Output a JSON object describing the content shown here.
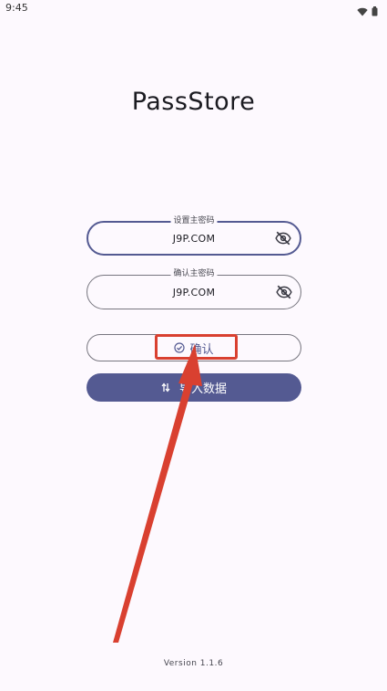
{
  "status_bar": {
    "time": "9:45",
    "icons": [
      "wifi-icon",
      "battery-icon"
    ]
  },
  "app": {
    "title": "PassStore",
    "version": "Version 1.1.6"
  },
  "form": {
    "set_password": {
      "label": "设置主密码",
      "value": "J9P.COM",
      "visibility_icon": "eye-off-icon"
    },
    "confirm_password": {
      "label": "确认主密码",
      "value": "J9P.COM",
      "visibility_icon": "eye-off-icon"
    }
  },
  "buttons": {
    "confirm": {
      "label": "确认",
      "icon": "check-circle-icon"
    },
    "import": {
      "label": "导入数据",
      "icon": "swap-vertical-icon"
    }
  },
  "colors": {
    "primary": "#545a92",
    "background": "#fdf9fe",
    "annotation": "#d94030"
  }
}
